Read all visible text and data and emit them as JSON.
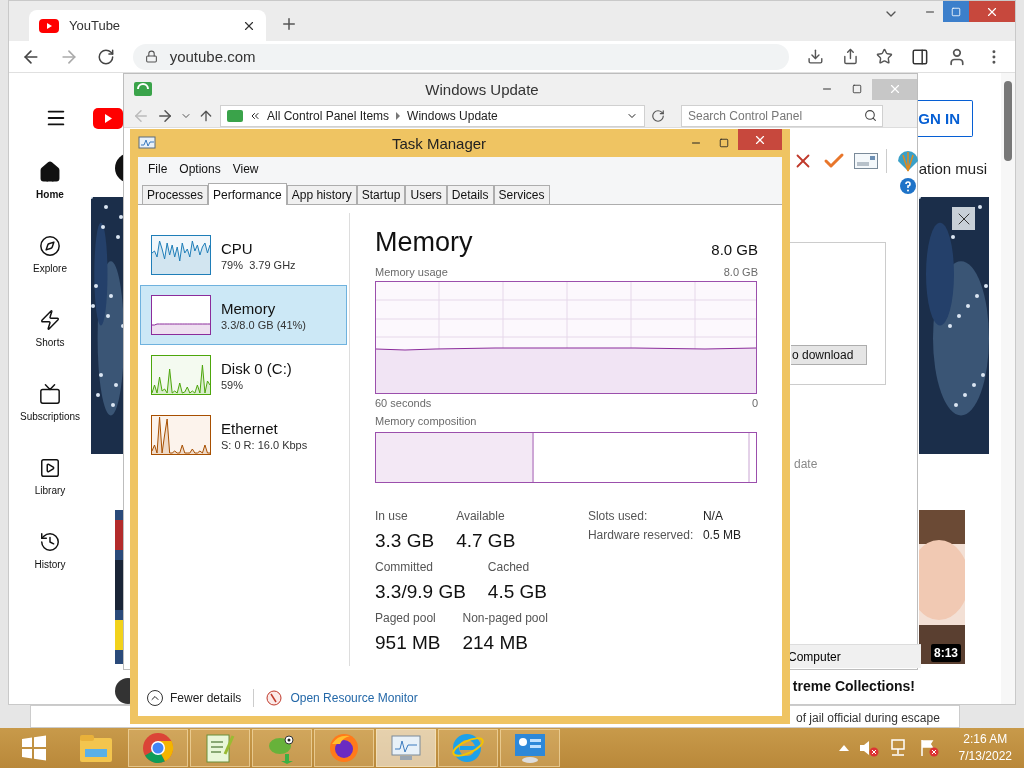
{
  "browser": {
    "tab": {
      "title": "YouTube"
    },
    "address": "youtube.com",
    "youtube": {
      "sidebar": [
        {
          "kind": "home",
          "label": "Home",
          "selected": true
        },
        {
          "kind": "explore",
          "label": "Explore",
          "selected": false
        },
        {
          "kind": "shorts",
          "label": "Shorts",
          "selected": false
        },
        {
          "kind": "subscriptions",
          "label": "Subscriptions",
          "selected": false
        },
        {
          "kind": "library",
          "label": "Library",
          "selected": false
        },
        {
          "kind": "history",
          "label": "History",
          "selected": false
        }
      ],
      "sign_in": "GN IN",
      "chip": "ation musi",
      "video": {
        "duration": "8:13",
        "title": "treme Collections!"
      }
    }
  },
  "back_window": {
    "text": "of jail official during escape"
  },
  "update_window": {
    "title": "Windows Update",
    "breadcrumb": [
      "All Control Panel Items",
      "Windows Update"
    ],
    "search": {
      "placeholder": "Search Control Panel"
    },
    "download_button": "o download",
    "status_text": "date",
    "footer": "Computer"
  },
  "task_manager": {
    "title": "Task Manager",
    "menu": [
      "File",
      "Options",
      "View"
    ],
    "tabs": [
      {
        "label": "Processes",
        "selected": false
      },
      {
        "label": "Performance",
        "selected": true
      },
      {
        "label": "App history",
        "selected": false
      },
      {
        "label": "Startup",
        "selected": false
      },
      {
        "label": "Users",
        "selected": false
      },
      {
        "label": "Details",
        "selected": false
      },
      {
        "label": "Services",
        "selected": false
      }
    ],
    "resources": [
      {
        "kind": "cpu",
        "name": "CPU",
        "detail": "79%  3.79 GHz",
        "selected": false
      },
      {
        "kind": "memory",
        "name": "Memory",
        "detail": "3.3/8.0 GB (41%)",
        "selected": true
      },
      {
        "kind": "disk",
        "name": "Disk 0 (C:)",
        "detail": "59%",
        "selected": false
      },
      {
        "kind": "ethernet",
        "name": "Ethernet",
        "detail": "S: 0 R: 16.0 Kbps",
        "selected": false
      }
    ],
    "panel": {
      "title": "Memory",
      "total": "8.0 GB",
      "usage_label": "Memory usage",
      "usage_max": "8.0 GB",
      "time_start": "60 seconds",
      "time_end": "0",
      "composition_label": "Memory composition",
      "stats": [
        {
          "label": "In use",
          "value": "3.3 GB"
        },
        {
          "label": "Available",
          "value": "4.7 GB"
        },
        {
          "label": "Committed",
          "value": "3.3/9.9 GB"
        },
        {
          "label": "Cached",
          "value": "4.5 GB"
        },
        {
          "label": "Paged pool",
          "value": "951 MB"
        },
        {
          "label": "Non-paged pool",
          "value": "214 MB"
        }
      ],
      "details": [
        {
          "label": "Slots used:",
          "value": "N/A"
        },
        {
          "label": "Hardware reserved:",
          "value": "0.5 MB"
        }
      ]
    },
    "footer": {
      "fewer_details": "Fewer details",
      "resource_monitor": "Open Resource Monitor"
    }
  },
  "taskbar": {
    "apps": [
      {
        "kind": "files",
        "running": false,
        "active": false
      },
      {
        "kind": "chrome",
        "running": true,
        "active": false
      },
      {
        "kind": "notepad",
        "running": true,
        "active": false
      },
      {
        "kind": "chameleon",
        "running": true,
        "active": false
      },
      {
        "kind": "firefox",
        "running": true,
        "active": false
      },
      {
        "kind": "monitor",
        "running": true,
        "active": true
      },
      {
        "kind": "ie",
        "running": true,
        "active": false
      },
      {
        "kind": "panel",
        "running": true,
        "active": false
      }
    ],
    "time": "2:16 AM",
    "date": "7/13/2022"
  }
}
